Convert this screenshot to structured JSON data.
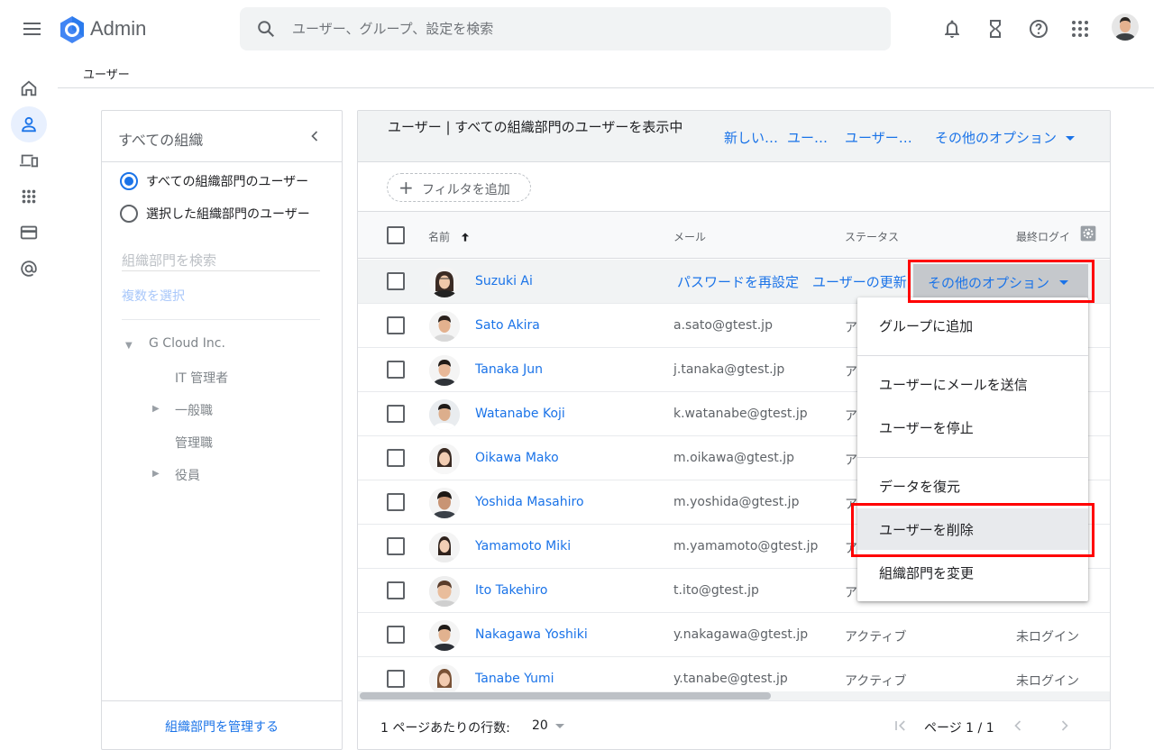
{
  "app": {
    "title": "Admin"
  },
  "search": {
    "placeholder": "ユーザー、グループ、設定を検索"
  },
  "breadcrumb": {
    "label": "ユーザー"
  },
  "org_panel": {
    "title": "すべての組織",
    "radio_all": "すべての組織部門のユーザー",
    "radio_selected": "選択した組織部門のユーザー",
    "search_placeholder": "組織部門を検索",
    "multi_select": "複数を選択",
    "tree": {
      "root": "G Cloud Inc.",
      "children": [
        "IT 管理者",
        "一般職",
        "管理職",
        "役員"
      ]
    },
    "manage_link": "組織部門を管理する"
  },
  "users_panel": {
    "title": "ユーザー | すべての組織部門のユーザーを表示中",
    "actions": [
      "新しい…",
      "ユー…",
      "ユーザー…",
      "その他のオプション"
    ],
    "filter_label": "フィルタを追加",
    "columns": {
      "name": "名前",
      "email": "メール",
      "status": "ステータス",
      "last_login": "最終ログイ"
    },
    "hover_row_actions": {
      "reset_password": "パスワードを再設定",
      "update_user": "ユーザーの更新",
      "more_options": "その他のオプション"
    },
    "rows": [
      {
        "name": "Suzuki Ai",
        "email": "",
        "status": "",
        "last_login": ""
      },
      {
        "name": "Sato Akira",
        "email": "a.sato@gtest.jp",
        "status": "ア",
        "last_login": ""
      },
      {
        "name": "Tanaka Jun",
        "email": "j.tanaka@gtest.jp",
        "status": "ア",
        "last_login": ""
      },
      {
        "name": "Watanabe Koji",
        "email": "k.watanabe@gtest.jp",
        "status": "ア",
        "last_login": ""
      },
      {
        "name": "Oikawa Mako",
        "email": "m.oikawa@gtest.jp",
        "status": "ア",
        "last_login": ""
      },
      {
        "name": "Yoshida Masahiro",
        "email": "m.yoshida@gtest.jp",
        "status": "ア",
        "last_login": ""
      },
      {
        "name": "Yamamoto Miki",
        "email": "m.yamamoto@gtest.jp",
        "status": "ア",
        "last_login": ""
      },
      {
        "name": "Ito Takehiro",
        "email": "t.ito@gtest.jp",
        "status": "ア",
        "last_login": ""
      },
      {
        "name": "Nakagawa Yoshiki",
        "email": "y.nakagawa@gtest.jp",
        "status": "アクティブ",
        "last_login": "未ログイン"
      },
      {
        "name": "Tanabe Yumi",
        "email": "y.tanabe@gtest.jp",
        "status": "アクティブ",
        "last_login": "未ログイン"
      }
    ],
    "pagination": {
      "rows_per_page_label": "1 ページあたりの行数:",
      "rows_per_page": "20",
      "page_label": "ページ 1 / 1"
    }
  },
  "more_options_menu": {
    "items": [
      "グループに追加",
      "ユーザーにメールを送信",
      "ユーザーを停止",
      "データを復元",
      "ユーザーを削除",
      "組織部門を変更"
    ],
    "highlighted": "ユーザーを削除"
  },
  "colors": {
    "accent": "#1a73e8",
    "highlight_box": "#ff0000",
    "logo_blue": "#4285f4"
  }
}
